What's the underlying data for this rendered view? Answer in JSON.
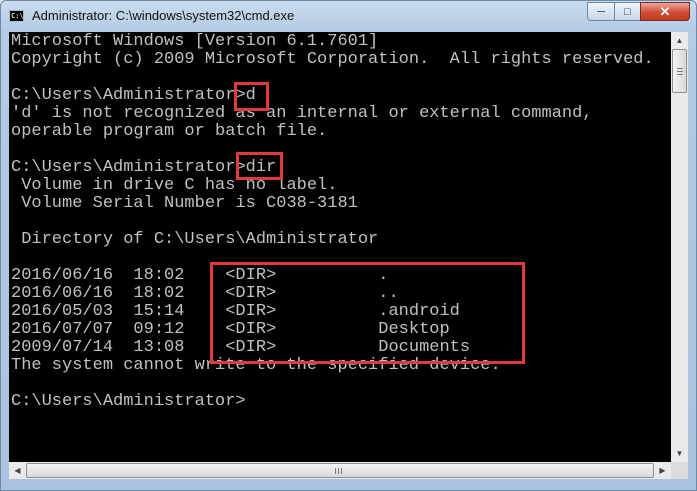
{
  "window": {
    "title": "Administrator: C:\\windows\\system32\\cmd.exe",
    "icon": "cmd-icon",
    "buttons": {
      "minimize": "─",
      "maximize": "□",
      "close": "✕"
    }
  },
  "console": {
    "lines": [
      "Microsoft Windows [Version 6.1.7601]",
      "Copyright (c) 2009 Microsoft Corporation.  All rights reserved.",
      "",
      "C:\\Users\\Administrator>d",
      "'d' is not recognized as an internal or external command,",
      "operable program or batch file.",
      "",
      "C:\\Users\\Administrator>dir",
      " Volume in drive C has no label.",
      " Volume Serial Number is C038-3181",
      "",
      " Directory of C:\\Users\\Administrator",
      "",
      "2016/06/16  18:02    <DIR>          .",
      "2016/06/16  18:02    <DIR>          ..",
      "2016/05/03  15:14    <DIR>          .android",
      "2016/07/07  09:12    <DIR>          Desktop",
      "2009/07/14  13:08    <DIR>          Documents",
      "The system cannot write to the specified device.",
      "",
      "C:\\Users\\Administrator>"
    ]
  },
  "scrollbar": {
    "up_arrow": "▲",
    "down_arrow": "▼",
    "left_arrow": "◀",
    "right_arrow": "▶"
  },
  "colors": {
    "console_bg": "#000000",
    "console_text": "#c0c0c0",
    "highlight": "#e03a3a"
  }
}
